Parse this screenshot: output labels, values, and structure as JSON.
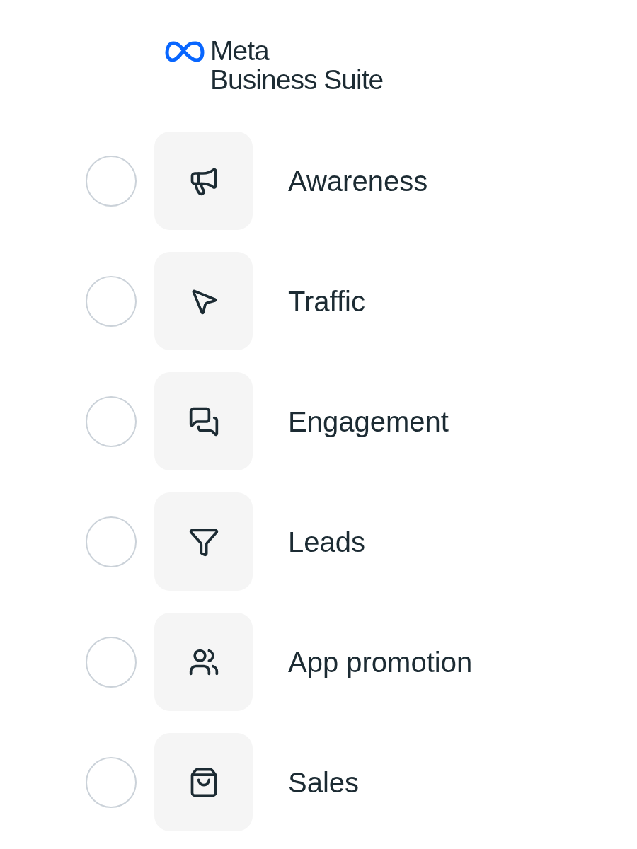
{
  "logo": {
    "line_1": "Meta",
    "line_2": "Business Suite"
  },
  "options": [
    {
      "label": "Awareness",
      "kind": "megaphone",
      "selected": false
    },
    {
      "label": "Traffic",
      "kind": "cursor",
      "selected": false
    },
    {
      "label": "Engagement",
      "kind": "chat",
      "selected": false
    },
    {
      "label": "Leads",
      "kind": "funnel",
      "selected": false
    },
    {
      "label": "App promotion",
      "kind": "people",
      "selected": false
    },
    {
      "label": "Sales",
      "kind": "bag",
      "selected": false
    }
  ]
}
